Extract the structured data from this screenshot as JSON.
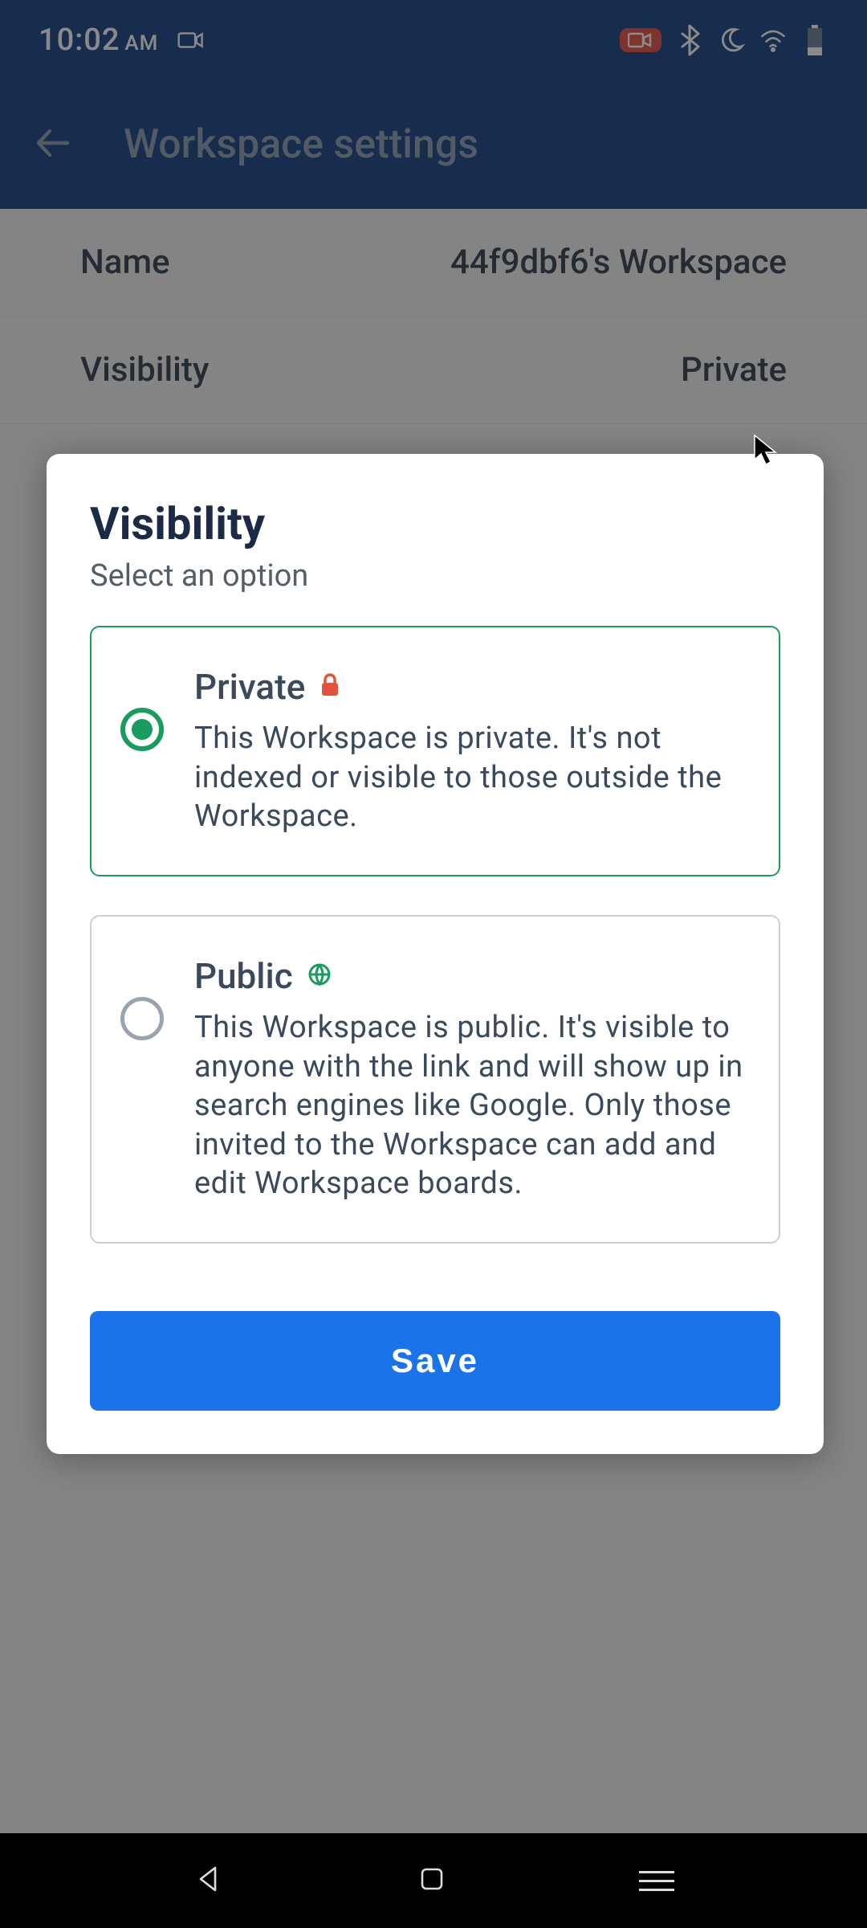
{
  "status": {
    "time": "10:02",
    "ampm": "AM"
  },
  "header": {
    "title": "Workspace settings"
  },
  "bg": {
    "name_label": "Name",
    "name_value": "44f9dbf6's Workspace",
    "visibility_label": "Visibility",
    "visibility_value": "Private"
  },
  "modal": {
    "title": "Visibility",
    "subtitle": "Select an option",
    "option_private": {
      "title": "Private",
      "desc": "This Workspace is private. It's not indexed or visible to those outside the Workspace."
    },
    "option_public": {
      "title": "Public",
      "desc": "This Workspace is public. It's visible to anyone with the link and will show up in search engines like Google. Only those invited to the Workspace can add and edit Workspace boards."
    },
    "save_label": "Save"
  }
}
